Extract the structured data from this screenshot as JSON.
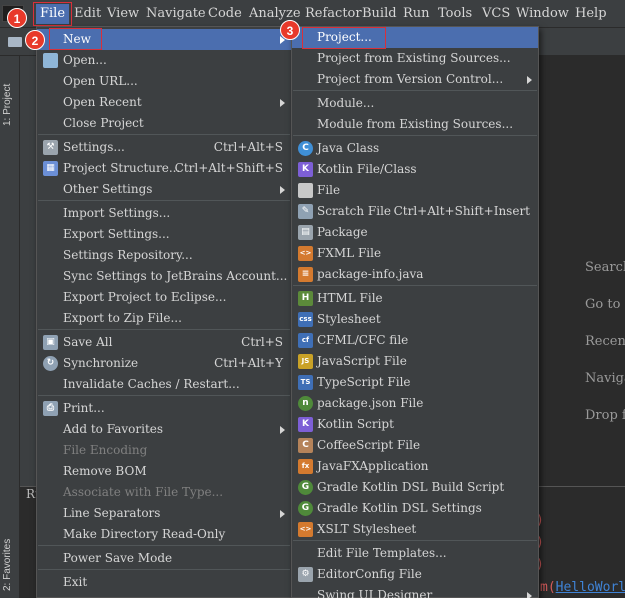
{
  "menubar": {
    "items": [
      "File",
      "Edit",
      "View",
      "Navigate",
      "Code",
      "Analyze",
      "Refactor",
      "Build",
      "Run",
      "Tools",
      "VCS",
      "Window",
      "Help"
    ]
  },
  "side": {
    "project_tab": "1: Project",
    "favorites_tab": "2: Favorites"
  },
  "bottom": {
    "run_label": "Ru",
    "code_method": "m(",
    "code_link": "HelloWorl"
  },
  "editor_hints": [
    "Search",
    "Go to F",
    "Recent",
    "Naviga",
    "Drop f"
  ],
  "badges": [
    "1",
    "2",
    "3"
  ],
  "file_menu": [
    {
      "label": "New",
      "shortcut": "",
      "submenu": true,
      "icon": "",
      "disabled": false,
      "selected": true
    },
    {
      "label": "Open...",
      "shortcut": "",
      "submenu": false,
      "icon": "folder-open-icon",
      "disabled": false
    },
    {
      "label": "Open URL...",
      "shortcut": "",
      "submenu": false,
      "icon": "",
      "disabled": false
    },
    {
      "label": "Open Recent",
      "shortcut": "",
      "submenu": true,
      "icon": "",
      "disabled": false
    },
    {
      "label": "Close Project",
      "shortcut": "",
      "submenu": false,
      "icon": "",
      "disabled": false
    },
    {
      "label": "Settings...",
      "shortcut": "Ctrl+Alt+S",
      "submenu": false,
      "icon": "wrench-icon",
      "disabled": false
    },
    {
      "label": "Project Structure...",
      "shortcut": "Ctrl+Alt+Shift+S",
      "submenu": false,
      "icon": "project-structure-icon",
      "disabled": false
    },
    {
      "label": "Other Settings",
      "shortcut": "",
      "submenu": true,
      "icon": "",
      "disabled": false
    },
    {
      "label": "Import Settings...",
      "shortcut": "",
      "submenu": false,
      "icon": "",
      "disabled": false
    },
    {
      "label": "Export Settings...",
      "shortcut": "",
      "submenu": false,
      "icon": "",
      "disabled": false
    },
    {
      "label": "Settings Repository...",
      "shortcut": "",
      "submenu": false,
      "icon": "",
      "disabled": false
    },
    {
      "label": "Sync Settings to JetBrains Account...",
      "shortcut": "",
      "submenu": false,
      "icon": "",
      "disabled": false
    },
    {
      "label": "Export Project to Eclipse...",
      "shortcut": "",
      "submenu": false,
      "icon": "",
      "disabled": false
    },
    {
      "label": "Export to Zip File...",
      "shortcut": "",
      "submenu": false,
      "icon": "",
      "disabled": false
    },
    {
      "label": "Save All",
      "shortcut": "Ctrl+S",
      "submenu": false,
      "icon": "save-icon",
      "disabled": false
    },
    {
      "label": "Synchronize",
      "shortcut": "Ctrl+Alt+Y",
      "submenu": false,
      "icon": "sync-icon",
      "disabled": false
    },
    {
      "label": "Invalidate Caches / Restart...",
      "shortcut": "",
      "submenu": false,
      "icon": "",
      "disabled": false
    },
    {
      "label": "Print...",
      "shortcut": "",
      "submenu": false,
      "icon": "print-icon",
      "disabled": false
    },
    {
      "label": "Add to Favorites",
      "shortcut": "",
      "submenu": true,
      "icon": "",
      "disabled": false
    },
    {
      "label": "File Encoding",
      "shortcut": "",
      "submenu": false,
      "icon": "",
      "disabled": true
    },
    {
      "label": "Remove BOM",
      "shortcut": "",
      "submenu": false,
      "icon": "",
      "disabled": false
    },
    {
      "label": "Associate with File Type...",
      "shortcut": "",
      "submenu": false,
      "icon": "",
      "disabled": true
    },
    {
      "label": "Line Separators",
      "shortcut": "",
      "submenu": true,
      "icon": "",
      "disabled": false
    },
    {
      "label": "Make Directory Read-Only",
      "shortcut": "",
      "submenu": false,
      "icon": "",
      "disabled": false
    },
    {
      "label": "Power Save Mode",
      "shortcut": "",
      "submenu": false,
      "icon": "",
      "disabled": false
    },
    {
      "label": "Exit",
      "shortcut": "",
      "submenu": false,
      "icon": "",
      "disabled": false
    }
  ],
  "new_menu": [
    {
      "label": "Project...",
      "shortcut": "",
      "submenu": false,
      "icon": "",
      "selected": true
    },
    {
      "label": "Project from Existing Sources...",
      "shortcut": "",
      "submenu": false,
      "icon": ""
    },
    {
      "label": "Project from Version Control...",
      "shortcut": "",
      "submenu": true,
      "icon": ""
    },
    {
      "label": "Module...",
      "shortcut": "",
      "submenu": false,
      "icon": ""
    },
    {
      "label": "Module from Existing Sources...",
      "shortcut": "",
      "submenu": false,
      "icon": ""
    },
    {
      "label": "Java Class",
      "shortcut": "",
      "submenu": false,
      "icon": "java-class-icon"
    },
    {
      "label": "Kotlin File/Class",
      "shortcut": "",
      "submenu": false,
      "icon": "kotlin-icon"
    },
    {
      "label": "File",
      "shortcut": "",
      "submenu": false,
      "icon": "file-icon"
    },
    {
      "label": "Scratch File",
      "shortcut": "Ctrl+Alt+Shift+Insert",
      "submenu": false,
      "icon": "scratch-file-icon"
    },
    {
      "label": "Package",
      "shortcut": "",
      "submenu": false,
      "icon": "package-icon"
    },
    {
      "label": "FXML File",
      "shortcut": "",
      "submenu": false,
      "icon": "fxml-icon"
    },
    {
      "label": "package-info.java",
      "shortcut": "",
      "submenu": false,
      "icon": "package-info-icon"
    },
    {
      "label": "HTML File",
      "shortcut": "",
      "submenu": false,
      "icon": "html-icon"
    },
    {
      "label": "Stylesheet",
      "shortcut": "",
      "submenu": false,
      "icon": "css-icon"
    },
    {
      "label": "CFML/CFC file",
      "shortcut": "",
      "submenu": false,
      "icon": "cfml-icon"
    },
    {
      "label": "JavaScript File",
      "shortcut": "",
      "submenu": false,
      "icon": "javascript-icon"
    },
    {
      "label": "TypeScript File",
      "shortcut": "",
      "submenu": false,
      "icon": "typescript-icon"
    },
    {
      "label": "package.json File",
      "shortcut": "",
      "submenu": false,
      "icon": "npm-icon"
    },
    {
      "label": "Kotlin Script",
      "shortcut": "",
      "submenu": false,
      "icon": "kotlin-script-icon"
    },
    {
      "label": "CoffeeScript File",
      "shortcut": "",
      "submenu": false,
      "icon": "coffeescript-icon"
    },
    {
      "label": "JavaFXApplication",
      "shortcut": "",
      "submenu": false,
      "icon": "javafx-icon"
    },
    {
      "label": "Gradle Kotlin DSL Build Script",
      "shortcut": "",
      "submenu": false,
      "icon": "gradle-icon"
    },
    {
      "label": "Gradle Kotlin DSL Settings",
      "shortcut": "",
      "submenu": false,
      "icon": "gradle-icon"
    },
    {
      "label": "XSLT Stylesheet",
      "shortcut": "",
      "submenu": false,
      "icon": "xslt-icon"
    },
    {
      "label": "Edit File Templates...",
      "shortcut": "",
      "submenu": false,
      "icon": ""
    },
    {
      "label": "EditorConfig File",
      "shortcut": "",
      "submenu": false,
      "icon": "gear-icon"
    },
    {
      "label": "Swing UI Designer",
      "shortcut": "",
      "submenu": true,
      "icon": ""
    }
  ],
  "colors": {
    "menu_bg": "#3c3f41",
    "selection": "#4b6eaf",
    "annotation_red": "#d9303a"
  }
}
